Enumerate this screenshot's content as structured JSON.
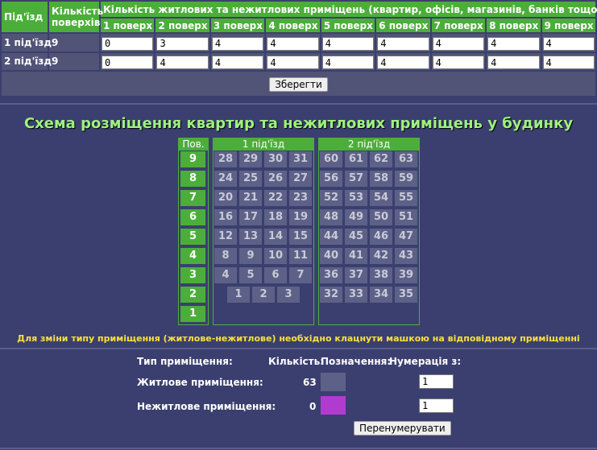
{
  "top_table": {
    "entrance_header": "Під'їзд",
    "floors_header": "Кількість поверхів",
    "rooms_header": "Кількість житлових та нежитлових приміщень (квартир, офісів, магазинів, банків тощо)",
    "floor_headers": [
      "1 поверх",
      "2 поверх",
      "3 поверх",
      "4 поверх",
      "5 поверх",
      "6 поверх",
      "7 поверх",
      "8 поверх",
      "9 поверх"
    ],
    "rows": [
      {
        "label": "1 під'їзд",
        "floors": "9",
        "values": [
          "0",
          "3",
          "4",
          "4",
          "4",
          "4",
          "4",
          "4",
          "4"
        ]
      },
      {
        "label": "2 під'їзд",
        "floors": "9",
        "values": [
          "0",
          "4",
          "4",
          "4",
          "4",
          "4",
          "4",
          "4",
          "4"
        ]
      }
    ],
    "save_label": "Зберегти"
  },
  "scheme": {
    "title": "Схема розміщення квартир та нежитлових приміщень у будинку",
    "floor_col_header": "Пов.",
    "floors": [
      "9",
      "8",
      "7",
      "6",
      "5",
      "4",
      "3",
      "2",
      "1"
    ],
    "entrance1_header": "1 під'їзд",
    "entrance2_header": "2 під'їзд",
    "entrance1_rows": [
      [
        "28",
        "29",
        "30",
        "31"
      ],
      [
        "24",
        "25",
        "26",
        "27"
      ],
      [
        "20",
        "21",
        "22",
        "23"
      ],
      [
        "16",
        "17",
        "18",
        "19"
      ],
      [
        "12",
        "13",
        "14",
        "15"
      ],
      [
        "8",
        "9",
        "10",
        "11"
      ],
      [
        "4",
        "5",
        "6",
        "7"
      ],
      [
        "1",
        "2",
        "3"
      ],
      []
    ],
    "entrance2_rows": [
      [
        "60",
        "61",
        "62",
        "63"
      ],
      [
        "56",
        "57",
        "58",
        "59"
      ],
      [
        "52",
        "53",
        "54",
        "55"
      ],
      [
        "48",
        "49",
        "50",
        "51"
      ],
      [
        "44",
        "45",
        "46",
        "47"
      ],
      [
        "40",
        "41",
        "42",
        "43"
      ],
      [
        "36",
        "37",
        "38",
        "39"
      ],
      [
        "32",
        "33",
        "34",
        "35"
      ],
      []
    ],
    "hint": "Для зміни типу приміщення (житлове-нежитлове) необхідно клацнути машкою на відповідному приміщенні"
  },
  "legend": {
    "type_header": "Тип приміщення:",
    "count_header": "Кількість:",
    "mark_header": "Позначення:",
    "numbering_header": "Нумерація з:",
    "residential_label": "Житлове приміщення:",
    "residential_count": "63",
    "residential_start": "1",
    "nonresidential_label": "Нежитлове приміщення:",
    "nonresidential_count": "0",
    "nonresidential_start": "1",
    "renumber_label": "Перенумерувати",
    "colors": {
      "residential": "#5e6187",
      "nonresidential": "#b03ccf"
    }
  }
}
